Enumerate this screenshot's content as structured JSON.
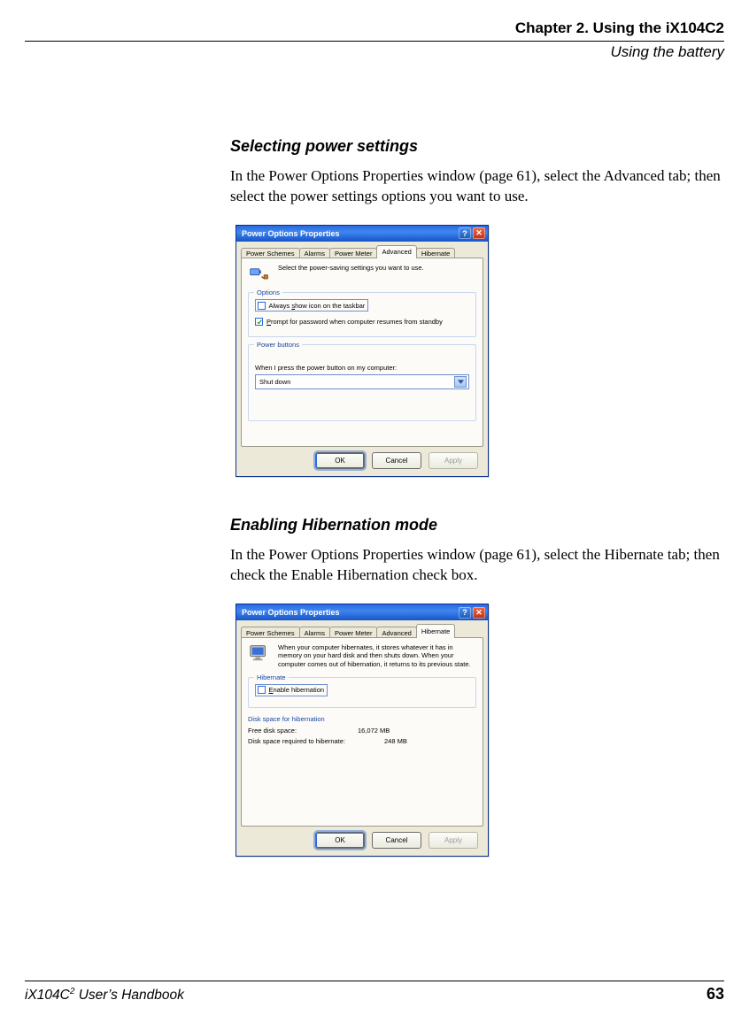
{
  "header": {
    "chapter": "Chapter 2. Using the iX104C2",
    "section": "Using the battery"
  },
  "sections": [
    {
      "heading": "Selecting power settings",
      "body": "In the Power Options Properties window (page 61), select the Advanced tab; then select the power settings options you want to use."
    },
    {
      "heading": "Enabling Hibernation mode",
      "body": "In the Power Options Properties window (page 61), select the Hibernate tab; then check the Enable Hibernation check box."
    }
  ],
  "dialog_advanced": {
    "title": "Power Options Properties",
    "tabs": [
      "Power Schemes",
      "Alarms",
      "Power Meter",
      "Advanced",
      "Hibernate"
    ],
    "selected_tab": "Advanced",
    "intro": "Select the power-saving settings you want to use.",
    "groups": {
      "options": {
        "legend": "Options",
        "cb1": {
          "label_pre": "Always ",
          "label_u": "s",
          "label_post": "how icon on the taskbar",
          "checked": false
        },
        "cb2": {
          "label_pre": "",
          "label_u": "P",
          "label_post": "rompt for password when computer resumes from standby",
          "checked": true
        }
      },
      "power_buttons": {
        "legend": "Power buttons",
        "question": "When I press the power button on my computer:",
        "value": "Shut down"
      }
    },
    "buttons": {
      "ok": "OK",
      "cancel": "Cancel",
      "apply": "Apply"
    }
  },
  "dialog_hibernate": {
    "title": "Power Options Properties",
    "tabs": [
      "Power Schemes",
      "Alarms",
      "Power Meter",
      "Advanced",
      "Hibernate"
    ],
    "selected_tab": "Hibernate",
    "intro": "When your computer hibernates, it stores whatever it has in memory on your hard disk and then shuts down. When your computer comes out of hibernation, it returns to its previous state.",
    "groups": {
      "hibernate": {
        "legend": "Hibernate",
        "cb": {
          "label_pre": "",
          "label_u": "E",
          "label_post": "nable hibernation",
          "checked": false
        }
      },
      "disk": {
        "legend": "Disk space for hibernation",
        "free_label": "Free disk space:",
        "free_value": "16,072 MB",
        "req_label": "Disk space required to hibernate:",
        "req_value": "248 MB"
      }
    },
    "buttons": {
      "ok": "OK",
      "cancel": "Cancel",
      "apply": "Apply"
    }
  },
  "footer": {
    "left_pre": "iX104C",
    "left_sup": "2",
    "left_post": " User’s Handbook",
    "page": "63"
  }
}
